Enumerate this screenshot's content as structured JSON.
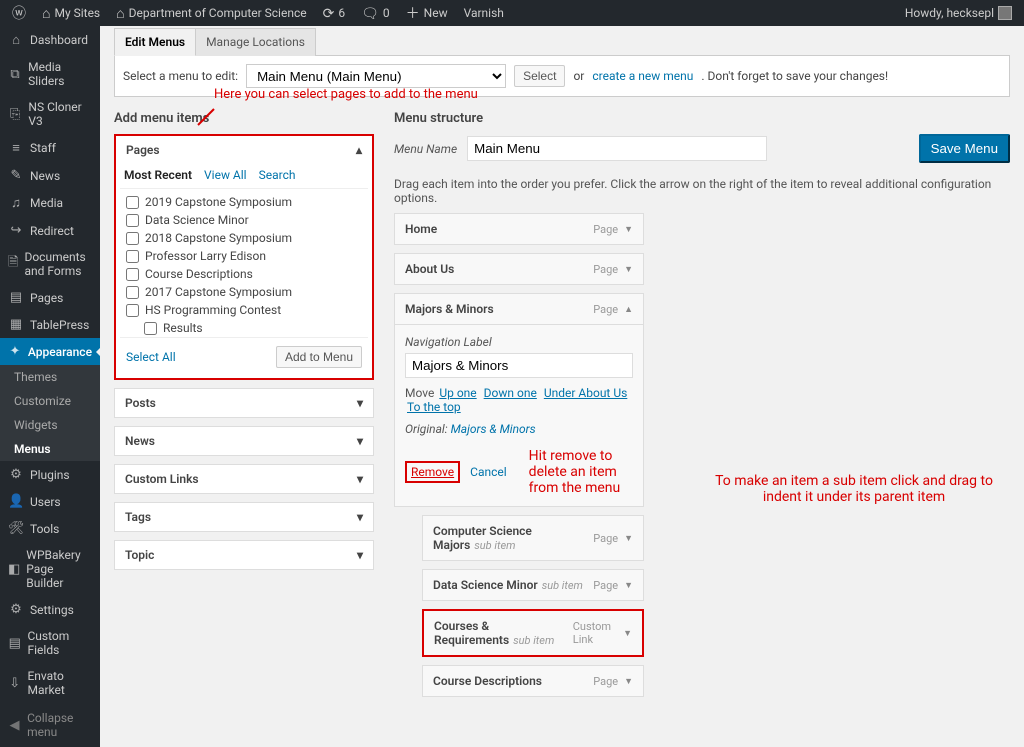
{
  "topbar": {
    "my_sites": "My Sites",
    "site_name": "Department of Computer Science",
    "refresh_count": "6",
    "comment_count": "0",
    "new": "New",
    "varnish": "Varnish",
    "howdy": "Howdy, hecksepl"
  },
  "sidebar": {
    "items": [
      {
        "icon": "⌂",
        "label": "Dashboard"
      },
      {
        "icon": "⧉",
        "label": "Media Sliders"
      },
      {
        "icon": "⎘",
        "label": "NS Cloner V3"
      },
      {
        "icon": "≡",
        "label": "Staff"
      },
      {
        "icon": "✎",
        "label": "News"
      },
      {
        "icon": "♫",
        "label": "Media"
      },
      {
        "icon": "↪",
        "label": "Redirect"
      },
      {
        "icon": "🗎",
        "label": "Documents and Forms"
      },
      {
        "icon": "▤",
        "label": "Pages"
      },
      {
        "icon": "▦",
        "label": "TablePress"
      },
      {
        "icon": "✦",
        "label": "Appearance"
      },
      {
        "icon": "⚙",
        "label": "Plugins"
      },
      {
        "icon": "👤",
        "label": "Users"
      },
      {
        "icon": "🛠",
        "label": "Tools"
      },
      {
        "icon": "◧",
        "label": "WPBakery Page Builder"
      },
      {
        "icon": "⚙",
        "label": "Settings"
      },
      {
        "icon": "▤",
        "label": "Custom Fields"
      },
      {
        "icon": "⇩",
        "label": "Envato Market"
      }
    ],
    "appearance_sub": [
      "Themes",
      "Customize",
      "Widgets",
      "Menus"
    ],
    "collapse": "Collapse menu"
  },
  "tabs": {
    "edit": "Edit Menus",
    "locations": "Manage Locations"
  },
  "selector": {
    "label": "Select a menu to edit:",
    "selected": "Main Menu (Main Menu)",
    "select_btn": "Select",
    "or": "or",
    "create": "create a new menu",
    "tail": ". Don't forget to save your changes!"
  },
  "annotations": {
    "select_pages": "Here you can select pages to add to the menu",
    "remove_hint": "Hit remove to delete an item from the menu",
    "subitem_hint1": "To make an item a sub item click and drag to",
    "subitem_hint2": "indent it under its parent item"
  },
  "left": {
    "heading": "Add menu items",
    "pages_title": "Pages",
    "minitabs": {
      "recent": "Most Recent",
      "viewall": "View All",
      "search": "Search"
    },
    "page_items": [
      "2019 Capstone Symposium",
      "Data Science Minor",
      "2018 Capstone Symposium",
      "Professor Larry Edison",
      "Course Descriptions",
      "2017 Capstone Symposium",
      "HS Programming Contest",
      "Results"
    ],
    "select_all": "Select All",
    "add_btn": "Add to Menu",
    "boxes": [
      "Posts",
      "News",
      "Custom Links",
      "Tags",
      "Topic"
    ]
  },
  "right": {
    "heading": "Menu structure",
    "menu_name_lbl": "Menu Name",
    "menu_name_val": "Main Menu",
    "save": "Save Menu",
    "hint": "Drag each item into the order you prefer. Click the arrow on the right of the item to reveal additional configuration options.",
    "items_closed": [
      {
        "title": "Home",
        "type": "Page"
      },
      {
        "title": "About Us",
        "type": "Page"
      }
    ],
    "open_item": {
      "title": "Majors & Minors",
      "type": "Page",
      "nav_label_lbl": "Navigation Label",
      "nav_label_val": "Majors & Minors",
      "move_lbl": "Move",
      "move_links": [
        "Up one",
        "Down one",
        "Under About Us",
        "To the top"
      ],
      "original_lbl": "Original:",
      "original_link": "Majors & Minors",
      "remove": "Remove",
      "cancel": "Cancel"
    },
    "children": [
      {
        "title": "Computer Science Majors",
        "sub": "sub item",
        "type": "Page"
      },
      {
        "title": "Data Science Minor",
        "sub": "sub item",
        "type": "Page"
      },
      {
        "title": "Courses & Requirements",
        "sub": "sub item",
        "type": "Custom Link",
        "highlight": true
      },
      {
        "title": "Course Descriptions",
        "sub": "",
        "type": "Page"
      }
    ]
  }
}
